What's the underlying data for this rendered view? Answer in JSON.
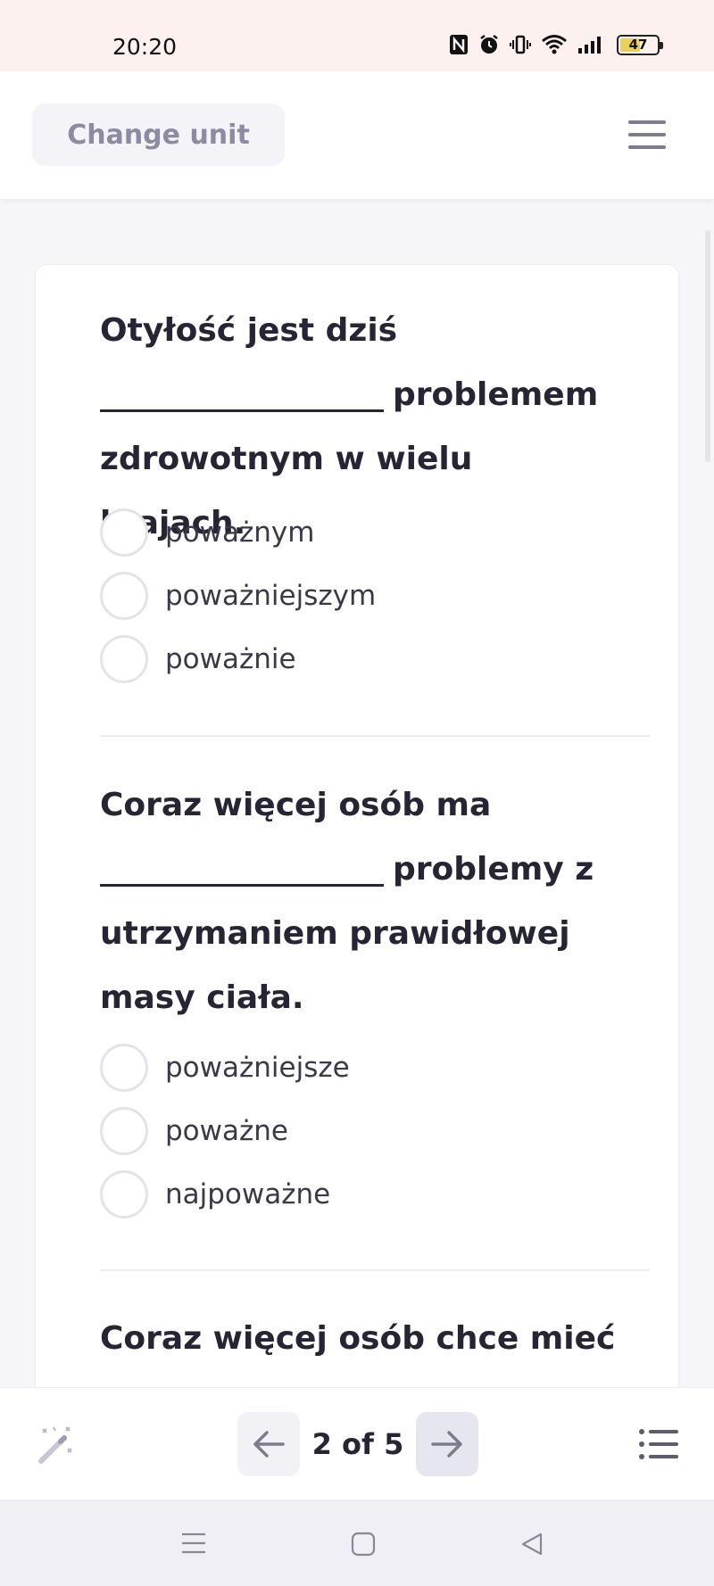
{
  "status_bar": {
    "time": "20:20",
    "battery": "47",
    "icons": [
      "nfc-icon",
      "alarm-icon",
      "vibrate-icon",
      "wifi-icon",
      "signal-icon",
      "battery-icon"
    ]
  },
  "header": {
    "change_unit_label": "Change unit",
    "menu_icon": "hamburger-menu-icon"
  },
  "questions": [
    {
      "line1": "Otyłość jest dziś",
      "after_blank": "problemem",
      "line3": "zdrowotnym w wielu krajach.",
      "line4": "",
      "options": [
        "poważnym",
        "poważniejszym",
        "poważnie"
      ]
    },
    {
      "line1": "Coraz więcej osób ma",
      "after_blank": "problemy z",
      "line3": "utrzymaniem prawidłowej",
      "line4": "masy ciała.",
      "options": [
        "poważniejsze",
        "poważne",
        "najpoważne"
      ]
    },
    {
      "line1": "Coraz więcej osób chce mieć"
    }
  ],
  "footer": {
    "wand_icon": "magic-wand-icon",
    "prev_icon": "arrow-left-icon",
    "page_indicator": "2 of 5",
    "next_icon": "arrow-right-icon",
    "list_icon": "list-icon"
  },
  "colors": {
    "status_bar_bg": "#fcf1ee",
    "text_primary": "#262534",
    "button_bg": "#f3f3f8",
    "button_text": "#8d8b9f",
    "battery_fill": "#e8d05a"
  }
}
